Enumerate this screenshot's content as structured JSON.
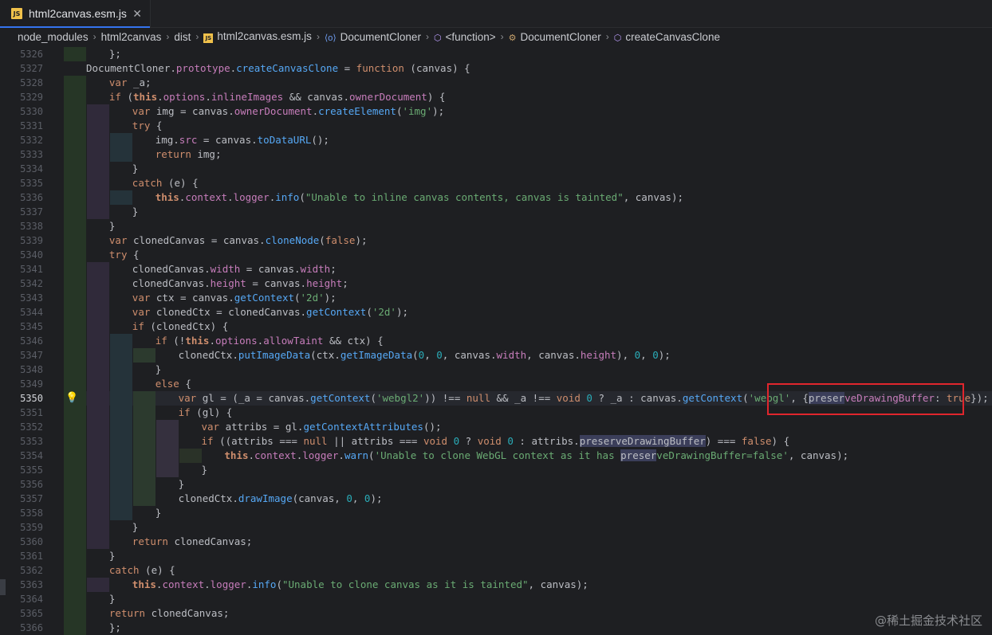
{
  "tab": {
    "badge": "JS",
    "title": "html2canvas.esm.js",
    "close": "✕"
  },
  "breadcrumb": [
    {
      "label": "node_modules",
      "icon": ""
    },
    {
      "label": "html2canvas",
      "icon": ""
    },
    {
      "label": "dist",
      "icon": ""
    },
    {
      "label": "html2canvas.esm.js",
      "icon": "js-file-icon"
    },
    {
      "label": "DocumentCloner",
      "icon": "class-icon"
    },
    {
      "label": "<function>",
      "icon": "function-icon"
    },
    {
      "label": "DocumentCloner",
      "icon": "constructor-icon"
    },
    {
      "label": "createCanvasClone",
      "icon": "method-icon"
    }
  ],
  "current_line": 5350,
  "watermark": "@稀土掘金技术社区",
  "lines": [
    {
      "n": "5326",
      "d": 1,
      "t": [
        [
          "id",
          "};"
        ]
      ]
    },
    {
      "n": "5327",
      "d": 0,
      "t": [
        [
          "id",
          "DocumentCloner"
        ],
        [
          "id",
          "."
        ],
        [
          "prop",
          "prototype"
        ],
        [
          "id",
          "."
        ],
        [
          "fnc",
          "createCanvasClone"
        ],
        [
          "id",
          " = "
        ],
        [
          "kw",
          "function"
        ],
        [
          "id",
          " (canvas) {"
        ]
      ]
    },
    {
      "n": "5328",
      "d": 1,
      "t": [
        [
          "kw",
          "var"
        ],
        [
          "id",
          " _a;"
        ]
      ]
    },
    {
      "n": "5329",
      "d": 1,
      "t": [
        [
          "kw",
          "if"
        ],
        [
          "id",
          " ("
        ],
        [
          "this",
          "this"
        ],
        [
          "id",
          "."
        ],
        [
          "obj",
          "options"
        ],
        [
          "id",
          "."
        ],
        [
          "prop",
          "inlineImages"
        ],
        [
          "id",
          " && canvas."
        ],
        [
          "prop",
          "ownerDocument"
        ],
        [
          "id",
          ") {"
        ]
      ]
    },
    {
      "n": "5330",
      "d": 2,
      "t": [
        [
          "kw",
          "var"
        ],
        [
          "id",
          " img = canvas."
        ],
        [
          "prop",
          "ownerDocument"
        ],
        [
          "id",
          "."
        ],
        [
          "fnc",
          "createElement"
        ],
        [
          "id",
          "("
        ],
        [
          "str",
          "'img'"
        ],
        [
          "id",
          ");"
        ]
      ]
    },
    {
      "n": "5331",
      "d": 2,
      "t": [
        [
          "kw",
          "try"
        ],
        [
          "id",
          " {"
        ]
      ]
    },
    {
      "n": "5332",
      "d": 3,
      "t": [
        [
          "id",
          "img."
        ],
        [
          "prop",
          "src"
        ],
        [
          "id",
          " = canvas."
        ],
        [
          "fnc",
          "toDataURL"
        ],
        [
          "id",
          "();"
        ]
      ]
    },
    {
      "n": "5333",
      "d": 3,
      "t": [
        [
          "kw",
          "return"
        ],
        [
          "id",
          " img;"
        ]
      ]
    },
    {
      "n": "5334",
      "d": 2,
      "t": [
        [
          "id",
          "}"
        ]
      ]
    },
    {
      "n": "5335",
      "d": 2,
      "t": [
        [
          "kw",
          "catch"
        ],
        [
          "id",
          " (e) {"
        ]
      ]
    },
    {
      "n": "5336",
      "d": 3,
      "t": [
        [
          "this",
          "this"
        ],
        [
          "id",
          "."
        ],
        [
          "obj",
          "context"
        ],
        [
          "id",
          "."
        ],
        [
          "obj",
          "logger"
        ],
        [
          "id",
          "."
        ],
        [
          "fnc",
          "info"
        ],
        [
          "id",
          "("
        ],
        [
          "str",
          "\"Unable to inline canvas contents, canvas is tainted\""
        ],
        [
          "id",
          ", canvas);"
        ]
      ]
    },
    {
      "n": "5337",
      "d": 2,
      "t": [
        [
          "id",
          "}"
        ]
      ]
    },
    {
      "n": "5338",
      "d": 1,
      "t": [
        [
          "id",
          "}"
        ]
      ]
    },
    {
      "n": "5339",
      "d": 1,
      "t": [
        [
          "kw",
          "var"
        ],
        [
          "id",
          " clonedCanvas = canvas."
        ],
        [
          "fnc",
          "cloneNode"
        ],
        [
          "id",
          "("
        ],
        [
          "kw",
          "false"
        ],
        [
          "id",
          ");"
        ]
      ]
    },
    {
      "n": "5340",
      "d": 1,
      "t": [
        [
          "kw",
          "try"
        ],
        [
          "id",
          " {"
        ]
      ]
    },
    {
      "n": "5341",
      "d": 2,
      "t": [
        [
          "id",
          "clonedCanvas."
        ],
        [
          "prop",
          "width"
        ],
        [
          "id",
          " = canvas."
        ],
        [
          "prop",
          "width"
        ],
        [
          "id",
          ";"
        ]
      ]
    },
    {
      "n": "5342",
      "d": 2,
      "t": [
        [
          "id",
          "clonedCanvas."
        ],
        [
          "prop",
          "height"
        ],
        [
          "id",
          " = canvas."
        ],
        [
          "prop",
          "height"
        ],
        [
          "id",
          ";"
        ]
      ]
    },
    {
      "n": "5343",
      "d": 2,
      "t": [
        [
          "kw",
          "var"
        ],
        [
          "id",
          " ctx = canvas."
        ],
        [
          "fnc",
          "getContext"
        ],
        [
          "id",
          "("
        ],
        [
          "str",
          "'2d'"
        ],
        [
          "id",
          ");"
        ]
      ]
    },
    {
      "n": "5344",
      "d": 2,
      "t": [
        [
          "kw",
          "var"
        ],
        [
          "id",
          " clonedCtx = clonedCanvas."
        ],
        [
          "fnc",
          "getContext"
        ],
        [
          "id",
          "("
        ],
        [
          "str",
          "'2d'"
        ],
        [
          "id",
          ");"
        ]
      ]
    },
    {
      "n": "5345",
      "d": 2,
      "t": [
        [
          "kw",
          "if"
        ],
        [
          "id",
          " (clonedCtx) {"
        ]
      ]
    },
    {
      "n": "5346",
      "d": 3,
      "t": [
        [
          "kw",
          "if"
        ],
        [
          "id",
          " (!"
        ],
        [
          "this",
          "this"
        ],
        [
          "id",
          "."
        ],
        [
          "obj",
          "options"
        ],
        [
          "id",
          "."
        ],
        [
          "prop",
          "allowTaint"
        ],
        [
          "id",
          " && ctx) {"
        ]
      ]
    },
    {
      "n": "5347",
      "d": 4,
      "t": [
        [
          "id",
          "clonedCtx."
        ],
        [
          "fnc",
          "putImageData"
        ],
        [
          "id",
          "(ctx."
        ],
        [
          "fnc",
          "getImageData"
        ],
        [
          "id",
          "("
        ],
        [
          "num",
          "0"
        ],
        [
          "id",
          ", "
        ],
        [
          "num",
          "0"
        ],
        [
          "id",
          ", canvas."
        ],
        [
          "prop",
          "width"
        ],
        [
          "id",
          ", canvas."
        ],
        [
          "prop",
          "height"
        ],
        [
          "id",
          "), "
        ],
        [
          "num",
          "0"
        ],
        [
          "id",
          ", "
        ],
        [
          "num",
          "0"
        ],
        [
          "id",
          ");"
        ]
      ]
    },
    {
      "n": "5348",
      "d": 3,
      "t": [
        [
          "id",
          "}"
        ]
      ]
    },
    {
      "n": "5349",
      "d": 3,
      "t": [
        [
          "kw",
          "else"
        ],
        [
          "id",
          " {"
        ]
      ]
    },
    {
      "n": "5350",
      "d": 4,
      "t": [
        [
          "kw",
          "var"
        ],
        [
          "id",
          " gl = (_a = canvas."
        ],
        [
          "fnc",
          "getContext"
        ],
        [
          "id",
          "("
        ],
        [
          "str",
          "'webgl2'"
        ],
        [
          "id",
          ")) !== "
        ],
        [
          "kw",
          "null"
        ],
        [
          "id",
          " && _a !== "
        ],
        [
          "kw",
          "void"
        ],
        [
          "id",
          " "
        ],
        [
          "num",
          "0"
        ],
        [
          "id",
          " ? _a : canvas."
        ],
        [
          "fnc",
          "getContext"
        ],
        [
          "id",
          "("
        ],
        [
          "str",
          "'webgl'"
        ],
        [
          "id",
          ", {"
        ],
        [
          "mark",
          "preser"
        ],
        [
          "prop",
          "veDrawingBuffer"
        ],
        [
          "id",
          ": "
        ],
        [
          "kw",
          "true"
        ],
        [
          "id",
          "});"
        ]
      ]
    },
    {
      "n": "5351",
      "d": 4,
      "t": [
        [
          "kw",
          "if"
        ],
        [
          "id",
          " (gl) {"
        ]
      ]
    },
    {
      "n": "5352",
      "d": 5,
      "t": [
        [
          "kw",
          "var"
        ],
        [
          "id",
          " attribs = gl."
        ],
        [
          "fnc",
          "getContextAttributes"
        ],
        [
          "id",
          "();"
        ]
      ]
    },
    {
      "n": "5353",
      "d": 5,
      "t": [
        [
          "kw",
          "if"
        ],
        [
          "id",
          " ((attribs === "
        ],
        [
          "kw",
          "null"
        ],
        [
          "id",
          " || attribs === "
        ],
        [
          "kw",
          "void"
        ],
        [
          "id",
          " "
        ],
        [
          "num",
          "0"
        ],
        [
          "id",
          " ? "
        ],
        [
          "kw",
          "void"
        ],
        [
          "id",
          " "
        ],
        [
          "num",
          "0"
        ],
        [
          "id",
          " : attribs."
        ],
        [
          "mark",
          "preserveDrawingBuffer"
        ],
        [
          "id",
          ") === "
        ],
        [
          "kw",
          "false"
        ],
        [
          "id",
          ") {"
        ]
      ]
    },
    {
      "n": "5354",
      "d": 6,
      "t": [
        [
          "this",
          "this"
        ],
        [
          "id",
          "."
        ],
        [
          "obj",
          "context"
        ],
        [
          "id",
          "."
        ],
        [
          "obj",
          "logger"
        ],
        [
          "id",
          "."
        ],
        [
          "fnc",
          "warn"
        ],
        [
          "id",
          "("
        ],
        [
          "str",
          "'Unable to clone WebGL context as it has "
        ],
        [
          "mark",
          "preser"
        ],
        [
          "str",
          "veDrawingBuffer=false'"
        ],
        [
          "id",
          ", canvas);"
        ]
      ]
    },
    {
      "n": "5355",
      "d": 5,
      "t": [
        [
          "id",
          "}"
        ]
      ]
    },
    {
      "n": "5356",
      "d": 4,
      "t": [
        [
          "id",
          "}"
        ]
      ]
    },
    {
      "n": "5357",
      "d": 4,
      "t": [
        [
          "id",
          "clonedCtx."
        ],
        [
          "fnc",
          "drawImage"
        ],
        [
          "id",
          "(canvas, "
        ],
        [
          "num",
          "0"
        ],
        [
          "id",
          ", "
        ],
        [
          "num",
          "0"
        ],
        [
          "id",
          ");"
        ]
      ]
    },
    {
      "n": "5358",
      "d": 3,
      "t": [
        [
          "id",
          "}"
        ]
      ]
    },
    {
      "n": "5359",
      "d": 2,
      "t": [
        [
          "id",
          "}"
        ]
      ]
    },
    {
      "n": "5360",
      "d": 2,
      "t": [
        [
          "kw",
          "return"
        ],
        [
          "id",
          " clonedCanvas;"
        ]
      ]
    },
    {
      "n": "5361",
      "d": 1,
      "t": [
        [
          "id",
          "}"
        ]
      ]
    },
    {
      "n": "5362",
      "d": 1,
      "t": [
        [
          "kw",
          "catch"
        ],
        [
          "id",
          " (e) {"
        ]
      ]
    },
    {
      "n": "5363",
      "d": 2,
      "t": [
        [
          "this",
          "this"
        ],
        [
          "id",
          "."
        ],
        [
          "obj",
          "context"
        ],
        [
          "id",
          "."
        ],
        [
          "obj",
          "logger"
        ],
        [
          "id",
          "."
        ],
        [
          "fnc",
          "info"
        ],
        [
          "id",
          "("
        ],
        [
          "str",
          "\"Unable to clone canvas as it is tainted\""
        ],
        [
          "id",
          ", canvas);"
        ]
      ]
    },
    {
      "n": "5364",
      "d": 1,
      "t": [
        [
          "id",
          "}"
        ]
      ]
    },
    {
      "n": "5365",
      "d": 1,
      "t": [
        [
          "kw",
          "return"
        ],
        [
          "id",
          " clonedCanvas;"
        ]
      ]
    },
    {
      "n": "5366",
      "d": 1,
      "t": [
        [
          "id",
          "};"
        ]
      ]
    }
  ]
}
